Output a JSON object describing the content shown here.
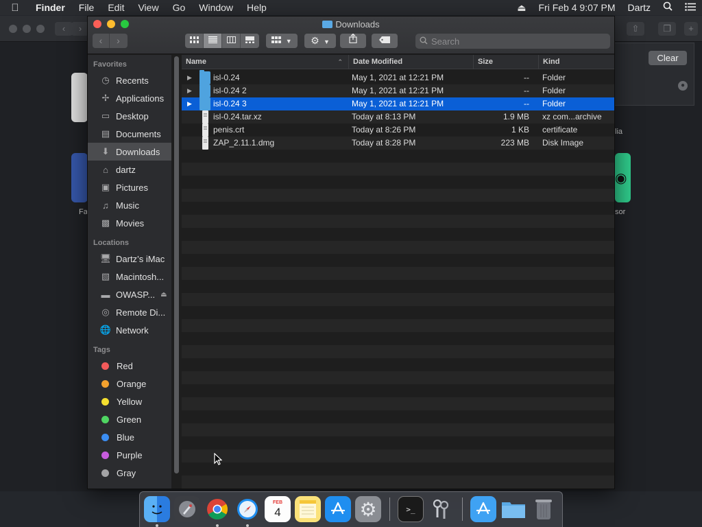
{
  "menubar": {
    "app_name": "Finder",
    "menus": [
      "File",
      "Edit",
      "View",
      "Go",
      "Window",
      "Help"
    ],
    "datetime": "Fri Feb 4  9:07 PM",
    "user": "Dartz"
  },
  "background_app": {
    "clear_label": "Clear",
    "labels": [
      "Fa",
      "lia",
      "sor"
    ]
  },
  "window": {
    "title": "Downloads",
    "search_placeholder": "Search"
  },
  "sidebar": {
    "favorites_title": "Favorites",
    "favorites": [
      "Recents",
      "Applications",
      "Desktop",
      "Documents",
      "Downloads",
      "dartz",
      "Pictures",
      "Music",
      "Movies"
    ],
    "locations_title": "Locations",
    "locations": [
      "Dartz’s iMac",
      "Macintosh...",
      "OWASP...",
      "Remote Di...",
      "Network"
    ],
    "tags_title": "Tags",
    "tags": [
      {
        "label": "Red",
        "color": "#f25a5a"
      },
      {
        "label": "Orange",
        "color": "#f3a12e"
      },
      {
        "label": "Yellow",
        "color": "#f4df2f"
      },
      {
        "label": "Green",
        "color": "#4fd562"
      },
      {
        "label": "Blue",
        "color": "#3b8df2"
      },
      {
        "label": "Purple",
        "color": "#c85cde"
      },
      {
        "label": "Gray",
        "color": "#a4a4a6"
      }
    ]
  },
  "columns": {
    "name": "Name",
    "date": "Date Modified",
    "size": "Size",
    "kind": "Kind"
  },
  "files": [
    {
      "name": "isl-0.24",
      "date": "May 1, 2021 at 12:21 PM",
      "size": "--",
      "kind": "Folder"
    },
    {
      "name": "isl-0.24 2",
      "date": "May 1, 2021 at 12:21 PM",
      "size": "--",
      "kind": "Folder"
    },
    {
      "name": "isl-0.24 3",
      "date": "May 1, 2021 at 12:21 PM",
      "size": "--",
      "kind": "Folder"
    },
    {
      "name": "isl-0.24.tar.xz",
      "date": "Today at 8:13 PM",
      "size": "1.9 MB",
      "kind": "xz com...archive"
    },
    {
      "name": "penis.crt",
      "date": "Today at 8:26 PM",
      "size": "1 KB",
      "kind": "certificate"
    },
    {
      "name": "ZAP_2.11.1.dmg",
      "date": "Today at 8:28 PM",
      "size": "223 MB",
      "kind": "Disk Image"
    }
  ],
  "dock": {
    "apps": [
      "finder-icon",
      "launchpad-icon",
      "chrome-icon",
      "safari-icon",
      "calendar-icon",
      "notes-icon",
      "app-store-icon",
      "system-preferences-icon",
      "terminal-icon",
      "keychain-icon",
      "applications-folder-icon",
      "downloads-folder-icon",
      "trash-icon"
    ],
    "calendar_month": "FEB",
    "calendar_day": "4"
  },
  "colors": {
    "selection": "#0a5fd6",
    "folder": "#4fa3df"
  }
}
